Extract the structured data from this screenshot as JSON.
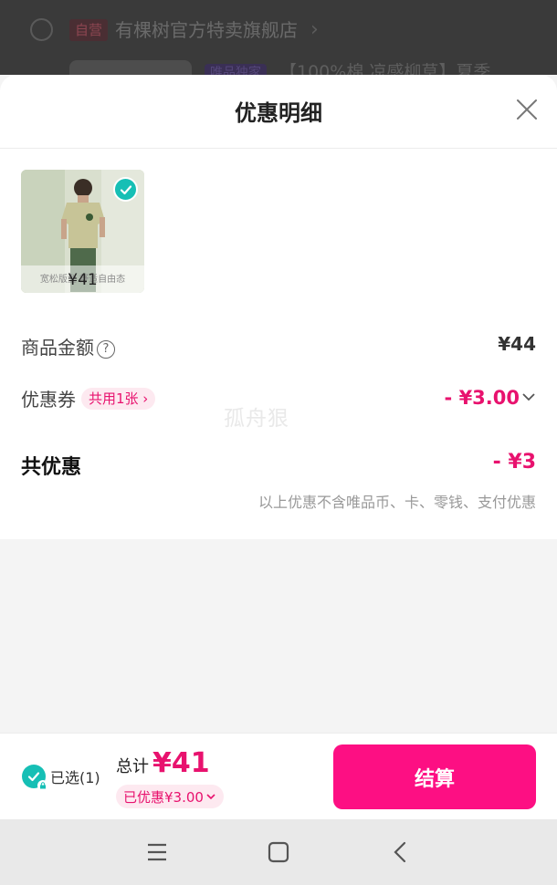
{
  "background_page": {
    "tag": "自营",
    "store_name": "有棵树官方特卖旗舰店",
    "badge": "唯品独家",
    "product_title": "【100%棉 凉感柳草】夏季"
  },
  "sheet": {
    "title": "优惠明细",
    "close_icon": "close-icon"
  },
  "product": {
    "price": "¥41",
    "overlay_desc": "宽松版型 舒适自由态",
    "selected": true
  },
  "amount": {
    "label": "商品金额",
    "value": "¥44"
  },
  "coupon": {
    "label": "优惠券",
    "chip": "共用1张 ›",
    "value": "- ¥3.00"
  },
  "watermark": "孤舟狠",
  "total_discount": {
    "label": "共优惠",
    "value": "- ¥3",
    "note": "以上优惠不含唯品币、卡、零钱、支付优惠"
  },
  "bottom_bar": {
    "selected_text": "已选(1)",
    "total_label": "总计",
    "total_price": "¥41",
    "saved_text": "已优惠¥3.00",
    "checkout_label": "结算"
  },
  "colors": {
    "accent": "#e8126e",
    "checkout": "#fd0f83",
    "check": "#16bfb5"
  }
}
